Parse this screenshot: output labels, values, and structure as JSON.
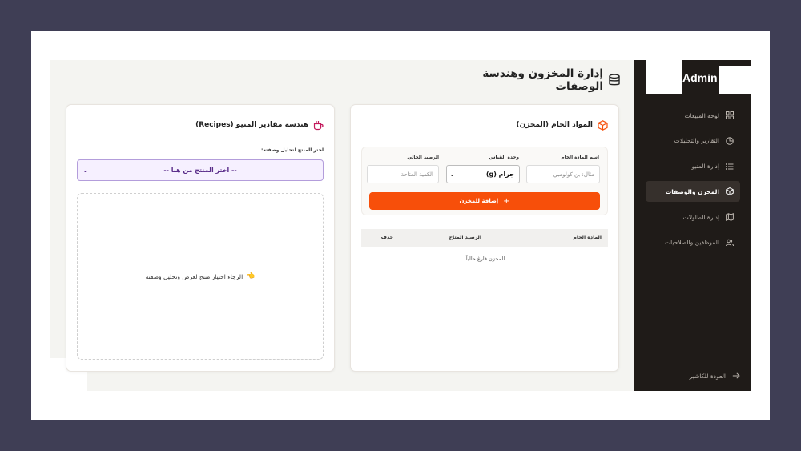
{
  "sidebar": {
    "brand": "Admin",
    "items": [
      {
        "label": "لوحة المبيعات",
        "icon": "dashboard-grid-icon",
        "active": false
      },
      {
        "label": "التقارير والتحليلات",
        "icon": "pie-chart-icon",
        "active": false
      },
      {
        "label": "إدارة المنيو",
        "icon": "list-icon",
        "active": false
      },
      {
        "label": "المخزن والوصفات",
        "icon": "box-icon",
        "active": true
      },
      {
        "label": "إدارة الطاولات",
        "icon": "map-icon",
        "active": false
      },
      {
        "label": "الموظفين والصلاحيات",
        "icon": "users-icon",
        "active": false
      }
    ],
    "back_label": "العودة للكاشير"
  },
  "page": {
    "title": "إدارة المخزون وهندسة الوصفات"
  },
  "recipes": {
    "title": "هندسة مقادير المنيو (Recipes)",
    "select_label": "اختر المنتج لتحليل وصفته:",
    "select_value": "-- اختر المنتج من هنا --",
    "empty_message": "الرجاء اختيار منتج لعرض وتحليل وصفته",
    "empty_emoji": "👈"
  },
  "inventory": {
    "title": "المواد الخام (المخزن)",
    "form": {
      "name_label": "اسم المادة الخام",
      "name_placeholder": "مثال: بن كولومبي",
      "unit_label": "وحدة القياس",
      "unit_value": "جرام (g)",
      "stock_label": "الرصيد الحالي",
      "stock_placeholder": "الكمية المتاحة",
      "add_button": "إضافة للمخزن"
    },
    "table": {
      "columns": [
        "المادة الخام",
        "الرصيد المتاح",
        "حذف"
      ],
      "empty_message": "المخزن فارغ حالياً."
    }
  },
  "colors": {
    "accent": "#f74f0a",
    "sidebar_bg": "#1f1b18",
    "select_border": "#b39ddb"
  }
}
